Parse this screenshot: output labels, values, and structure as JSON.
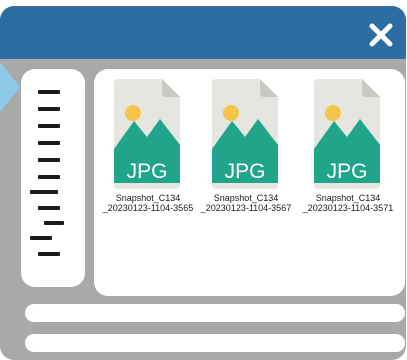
{
  "window": {
    "close_icon": "close-icon",
    "colors": {
      "titlebar": "#2e6da3",
      "frame": "#a9a9a9",
      "panel": "#ffffff",
      "jpg_band": "#20a58a",
      "mountain": "#20a58a",
      "sun": "#f3c64b",
      "page": "#e6e6e1"
    }
  },
  "sidebar": {
    "tick_count": 11
  },
  "files": [
    {
      "badge": "JPG",
      "name_line1": "Snapshot_C134",
      "name_line2": "_20230123-1104-3565",
      "icon": "image-file-icon"
    },
    {
      "badge": "JPG",
      "name_line1": "Snapshot_C134",
      "name_line2": "_20230123-1104-3567",
      "icon": "image-file-icon"
    },
    {
      "badge": "JPG",
      "name_line1": "Snapshot_C134",
      "name_line2": "_20230123-1104-3571",
      "icon": "image-file-icon"
    }
  ]
}
